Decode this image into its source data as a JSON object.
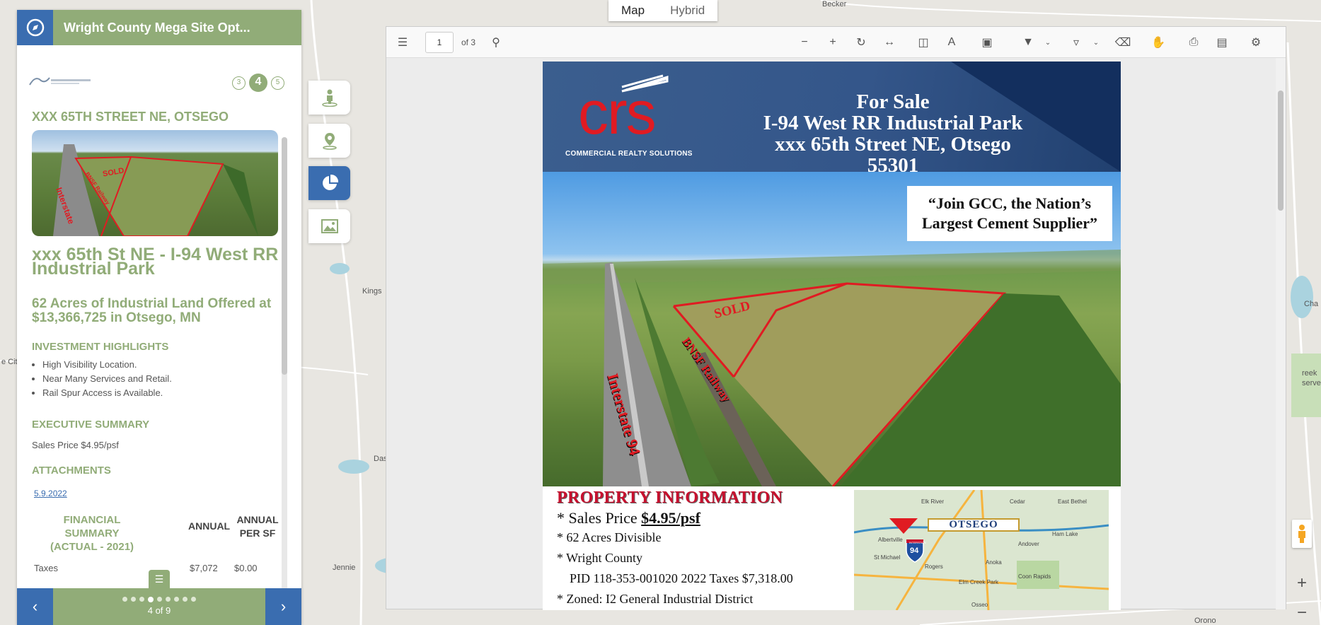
{
  "map": {
    "type_tabs": [
      "Map",
      "Hybrid"
    ],
    "labels": [
      "Becker",
      "Kings",
      "Das",
      "Jennie",
      "Orono",
      "Cha",
      "reek",
      "serve",
      "e City"
    ],
    "zoom_in": "+",
    "zoom_out": "−"
  },
  "panel": {
    "header_title": "Wright County Mega Site Opt...",
    "steps": [
      "3",
      "4",
      "5"
    ],
    "address": "XXX 65TH STREET NE, OTSEGO",
    "title": "xxx 65th St NE - I-94 West RR Industrial Park",
    "subtitle": "62 Acres of Industrial Land Offered at $13,366,725 in Otsego, MN",
    "highlights_heading": "INVESTMENT HIGHLIGHTS",
    "highlights": [
      "High Visibility Location.",
      "Near Many Services and Retail.",
      "Rail Spur Access is Available."
    ],
    "exec_heading": "EXECUTIVE SUMMARY",
    "sales_price": "Sales Price $4.95/psf",
    "attachments_heading": "ATTACHMENTS",
    "attachment_link": "5.9.2022",
    "fin_heading": "FINANCIAL SUMMARY (ACTUAL - 2021)",
    "fin_col_annual": "ANNUAL",
    "fin_col_per_sf": "ANNUAL PER SF",
    "fin_row_label": "Taxes",
    "fin_row_annual": "$7,072",
    "fin_row_per_sf": "$0.00",
    "photo_labels": {
      "sold": "SOLD",
      "interstate": "Interstate",
      "rail": "BNSF Railway"
    },
    "pager": "4 of 9",
    "pager_dots": 9,
    "pager_active": 4
  },
  "viewer": {
    "page_input": "1",
    "page_of": "of 3",
    "brochure": {
      "logo_text": "crs",
      "logo_sub": "COMMERCIAL REALTY SOLUTIONS",
      "line1": "For Sale",
      "line2": "I-94 West RR Industrial Park",
      "line3": "xxx 65th Street NE, Otsego 55301",
      "quote": "“Join GCC, the Nation’s Largest Cement Supplier”",
      "photo_sold": "SOLD",
      "photo_rail": "BNSF Railway",
      "photo_interstate": "Interstate 94",
      "info_heading": "PROPERTY INFORMATION",
      "info_price_prefix": "* Sales Price ",
      "info_price": "$4.95/psf",
      "info_acres": "* 62 Acres Divisible",
      "info_county": "* Wright County",
      "info_pid": "PID 118-353-001020  2022 Taxes $7,318.00",
      "info_zoned": "* Zoned: I2 General Industrial District",
      "map_otsego": "OTSEGO",
      "map_labels": [
        "Elk River",
        "Cedar",
        "East Bethel",
        "Albertville",
        "St Michael",
        "Rogers",
        "Anoka",
        "Andover",
        "Ham Lake",
        "Coon Rapids",
        "Elm Creek Park",
        "Osseo"
      ],
      "map_shield": "94",
      "map_interstate": "INTERSTATE"
    }
  }
}
